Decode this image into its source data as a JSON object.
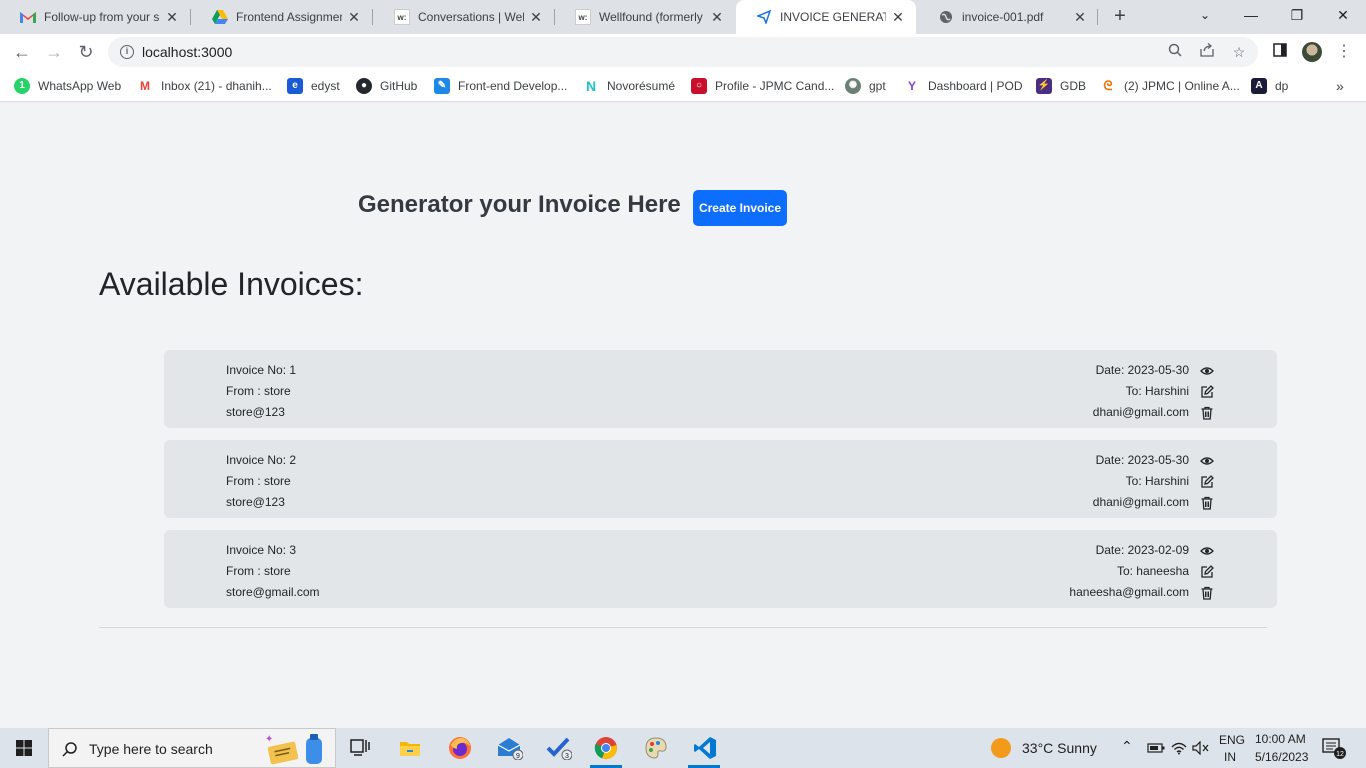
{
  "browser": {
    "tabs": [
      {
        "title": "Follow-up from your s",
        "favicon": "gmail-icon"
      },
      {
        "title": "Frontend Assignment",
        "favicon": "drive-icon"
      },
      {
        "title": "Conversations | Wellfo",
        "favicon": "wellfound-icon"
      },
      {
        "title": "Wellfound (formerly A",
        "favicon": "wellfound-icon"
      },
      {
        "title": "INVOICE GENERATOR",
        "favicon": "send-icon",
        "active": true
      },
      {
        "title": "invoice-001.pdf",
        "favicon": "globe-icon"
      }
    ],
    "url": "localhost:3000",
    "bookmarks": [
      "WhatsApp Web",
      "Inbox (21) - dhanih...",
      "edyst",
      "GitHub",
      "Front-end Develop...",
      "Novorésumé",
      "Profile - JPMC Cand...",
      "gpt",
      "Dashboard | POD",
      "GDB",
      "(2) JPMC | Online A...",
      "dp"
    ]
  },
  "page": {
    "heading": "Generator your Invoice Here",
    "create_button": "Create Invoice",
    "list_title": "Available Invoices:",
    "invoices": [
      {
        "number": "Invoice No: 1",
        "from": "From : store",
        "from_email": "store@123",
        "date": "Date: 2023-05-30",
        "to": "To: Harshini",
        "to_email": "dhani@gmail.com"
      },
      {
        "number": "Invoice No: 2",
        "from": "From : store",
        "from_email": "store@123",
        "date": "Date: 2023-05-30",
        "to": "To: Harshini",
        "to_email": "dhani@gmail.com"
      },
      {
        "number": "Invoice No: 3",
        "from": "From : store",
        "from_email": "store@gmail.com",
        "date": "Date: 2023-02-09",
        "to": "To: haneesha",
        "to_email": "haneesha@gmail.com"
      }
    ]
  },
  "taskbar": {
    "search_placeholder": "Type here to search",
    "mail_badge": "9",
    "todo_badge": "3",
    "weather": "33°C  Sunny",
    "lang_top": "ENG",
    "lang_bottom": "IN",
    "time": "10:00 AM",
    "date": "5/16/2023",
    "notif_count": "12"
  },
  "colors": {
    "accent": "#0d6efd",
    "card_bg": "#e3e6e9",
    "page_bg": "#f1f3f5"
  }
}
